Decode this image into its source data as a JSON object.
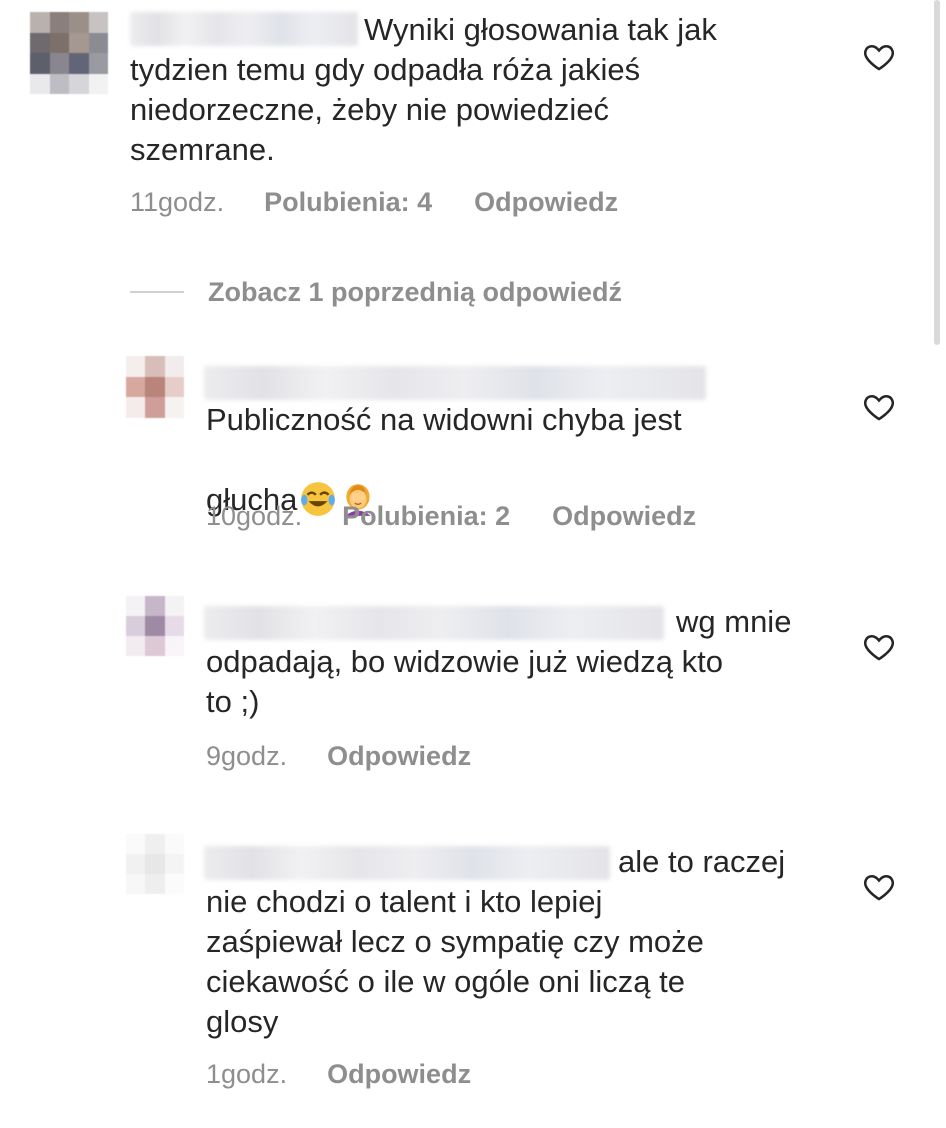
{
  "comments": [
    {
      "first_line": "Wyniki głosowania tak jak",
      "rest_lines": "tydzien temu gdy odpadła róża jakieś\nniedorzeczne, żeby nie powiedzieć\nszemrane.",
      "time": "11godz.",
      "likes": "Polubienia: 4",
      "reply": "Odpowiedz"
    },
    {
      "first_line": "Publiczność na widowni chyba jest",
      "rest_lines": "głucha",
      "emojis": [
        "face-with-tears-of-joy-emoji",
        "woman-facepalming-emoji"
      ],
      "time": "10godz.",
      "likes": "Polubienia: 2",
      "reply": "Odpowiedz"
    },
    {
      "first_line": "wg mnie",
      "rest_lines": "odpadają, bo widzowie już wiedzą kto\nto ;)",
      "time": "9godz.",
      "reply": "Odpowiedz"
    },
    {
      "first_line": "ale to raczej",
      "rest_lines": "nie chodzi o talent i kto lepiej\nzaśpiewał lecz o sympatię czy może\nciekawość o ile w ogóle oni liczą te\nglosy",
      "time": "1godz.",
      "reply": "Odpowiedz"
    }
  ],
  "view_replies": {
    "label": "Zobacz 1 poprzednią odpowiedź"
  },
  "icons": {
    "like": "heart-outline-icon"
  },
  "colors": {
    "text": "#262626",
    "secondary": "#8e8e8e",
    "background": "#ffffff"
  }
}
